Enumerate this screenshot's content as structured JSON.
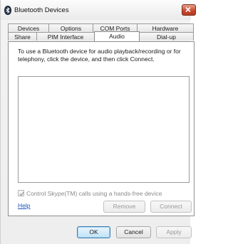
{
  "window": {
    "title": "Bluetooth Devices"
  },
  "tabs": {
    "row1": [
      "Devices",
      "Options",
      "COM Ports",
      "Hardware"
    ],
    "row2": [
      "Share",
      "PIM Interface",
      "Audio",
      "Dial-up"
    ],
    "active": "Audio"
  },
  "audio": {
    "description": "To use a Bluetooth device for audio playback/recording or for telephony, click the device, and then click Connect.",
    "skype_checkbox_label": "Control Skype(TM) calls using a hands-free device",
    "skype_checkbox_checked": true,
    "help_label": "Help",
    "remove_label": "Remove",
    "connect_label": "Connect"
  },
  "dialog_buttons": {
    "ok": "OK",
    "cancel": "Cancel",
    "apply": "Apply"
  },
  "icons": [
    "bluetooth-icon",
    "close-icon",
    "checkmark-icon"
  ]
}
